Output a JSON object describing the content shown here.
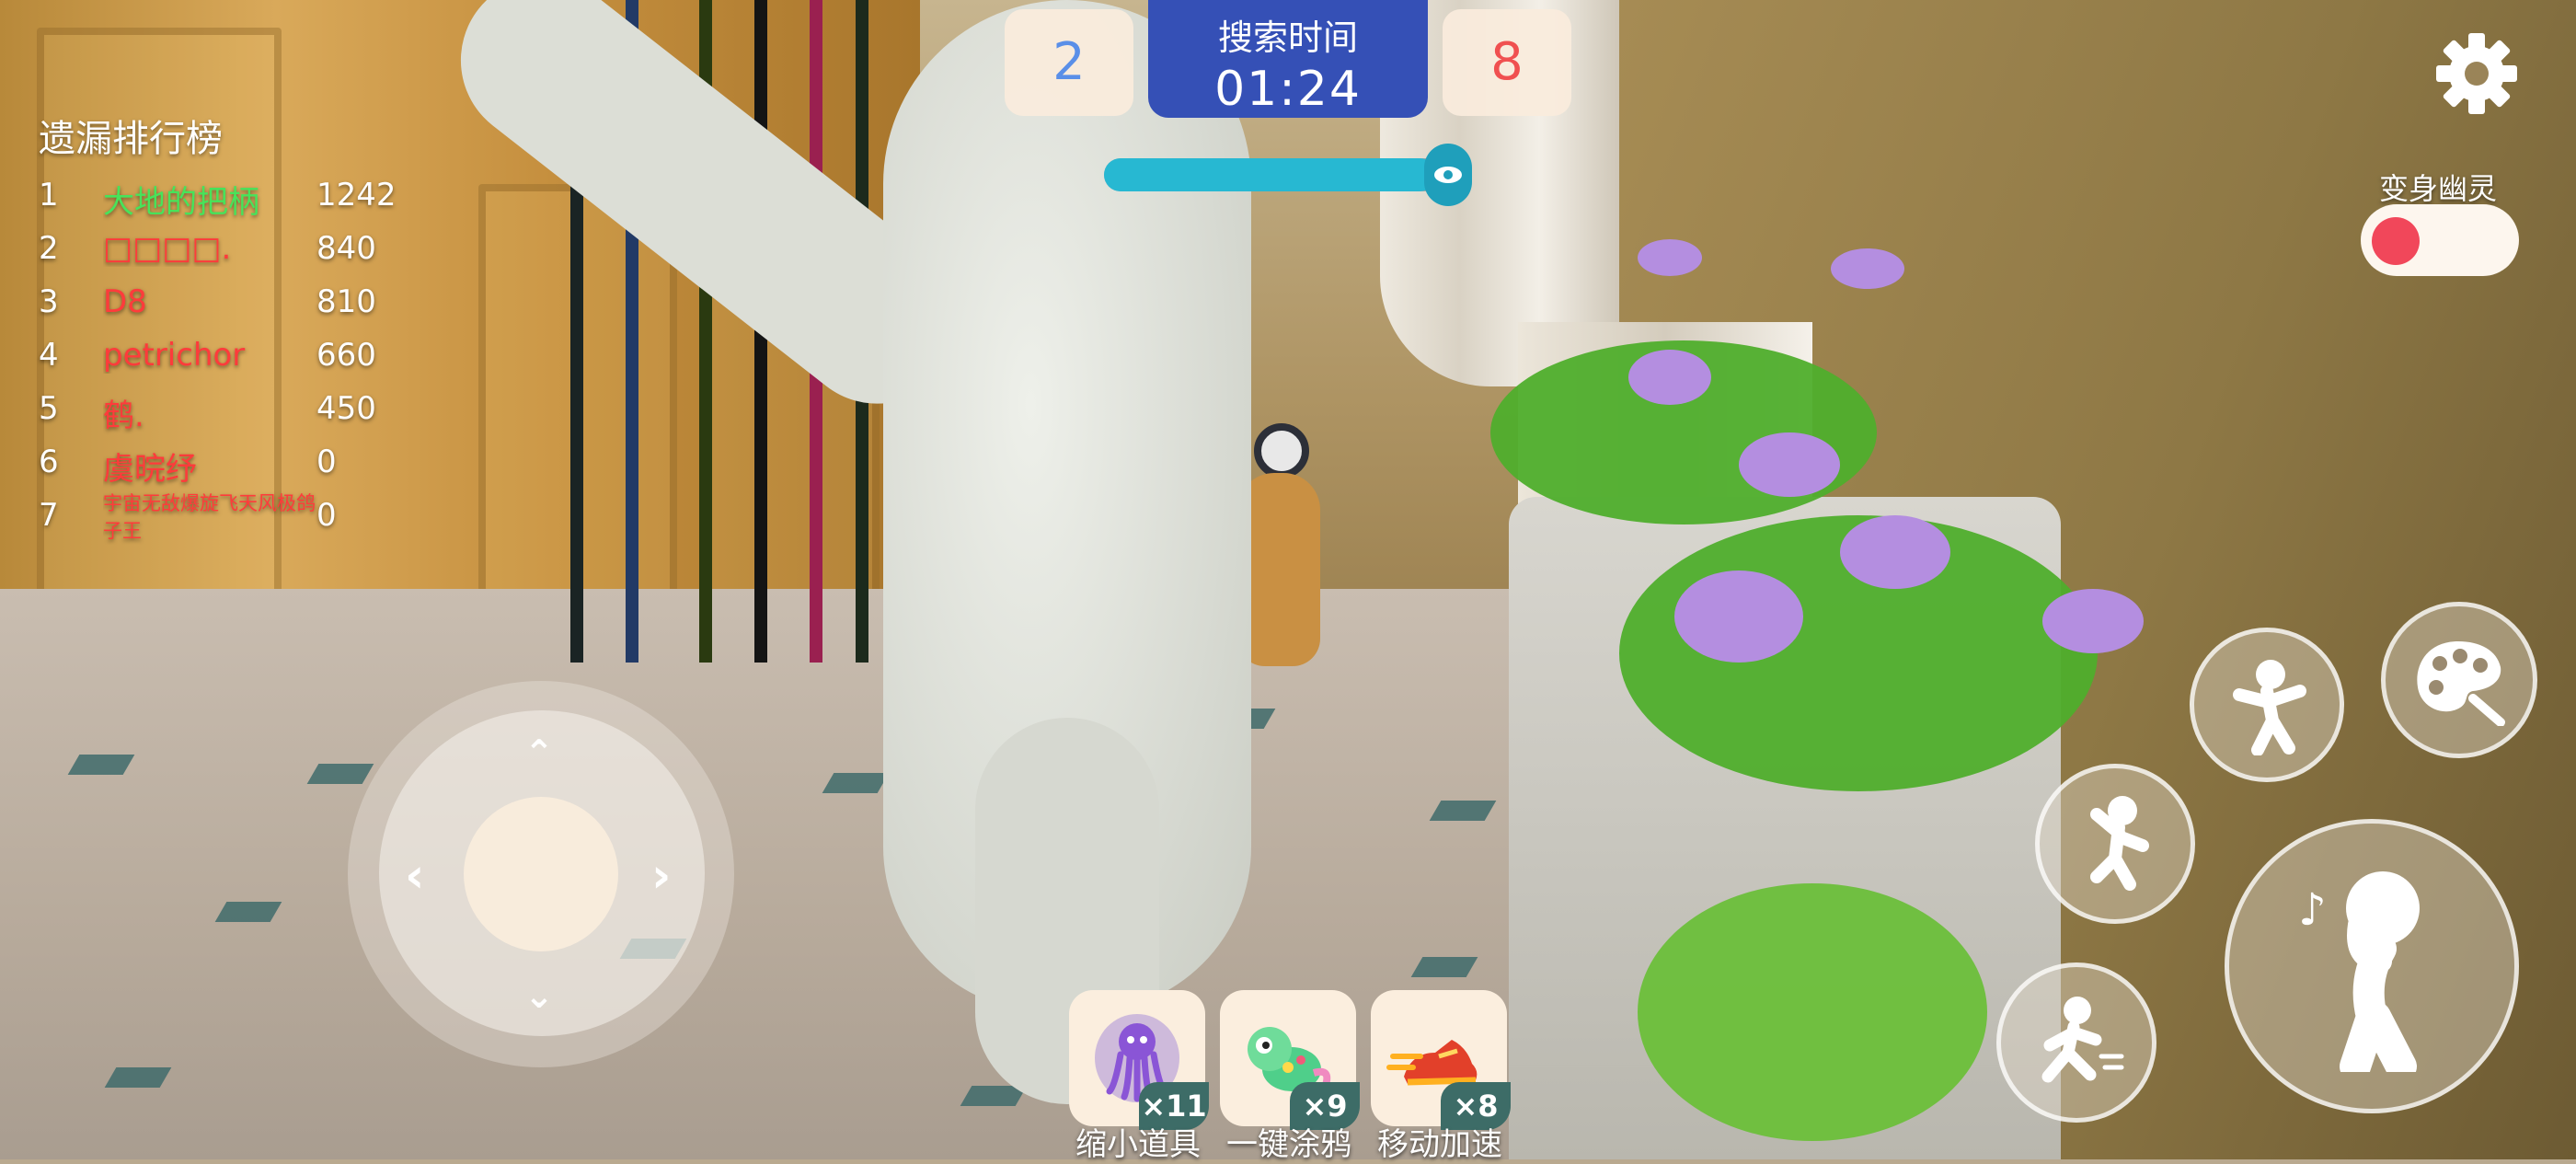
{
  "leaderboard": {
    "title": "遗漏排行榜",
    "rows": [
      {
        "rank": "1",
        "name": "大地的把柄",
        "score": "1242",
        "color": "#47e35a"
      },
      {
        "rank": "2",
        "name": "□□□□.",
        "score": "840",
        "color": "#ff3b3b"
      },
      {
        "rank": "3",
        "name": "D8",
        "score": "810",
        "color": "#ff3b3b"
      },
      {
        "rank": "4",
        "name": "petrichor",
        "score": "660",
        "color": "#ff3b3b"
      },
      {
        "rank": "5",
        "name": "鹤.",
        "score": "450",
        "color": "#ff3b3b"
      },
      {
        "rank": "6",
        "name": "虞晥纾",
        "score": "0",
        "color": "#ff3b3b"
      },
      {
        "rank": "7",
        "name": "宇宙无敌爆旋飞天风极鸽子王",
        "score": "0",
        "color": "#ff3b3b"
      }
    ]
  },
  "match": {
    "blue_score": "2",
    "red_score": "8",
    "blue_color": "#5a8fe8",
    "red_color": "#f05050",
    "timer_label": "搜索时间",
    "timer_value": "01:24",
    "progress_fraction": 0.95
  },
  "settings": {
    "icon": "gear-icon"
  },
  "ghost_toggle": {
    "label": "变身幽灵",
    "on": false
  },
  "joystick": {
    "up": "⌃",
    "down": "⌄",
    "left": "‹",
    "right": "›"
  },
  "items": [
    {
      "label": "缩小道具",
      "count": "×11",
      "icon": "octopus-shrink-icon"
    },
    {
      "label": "一键涂鸦",
      "count": "×9",
      "icon": "chameleon-paint-icon"
    },
    {
      "label": "移动加速",
      "count": "×8",
      "icon": "speed-shoe-icon"
    }
  ],
  "actions": [
    {
      "name": "emote-action-button",
      "icon": "pose-icon"
    },
    {
      "name": "paint-palette-button",
      "icon": "palette-icon"
    },
    {
      "name": "jump-button",
      "icon": "jump-icon"
    },
    {
      "name": "whistle-button",
      "icon": "whistle-icon"
    },
    {
      "name": "sprint-button",
      "icon": "run-icon"
    }
  ]
}
